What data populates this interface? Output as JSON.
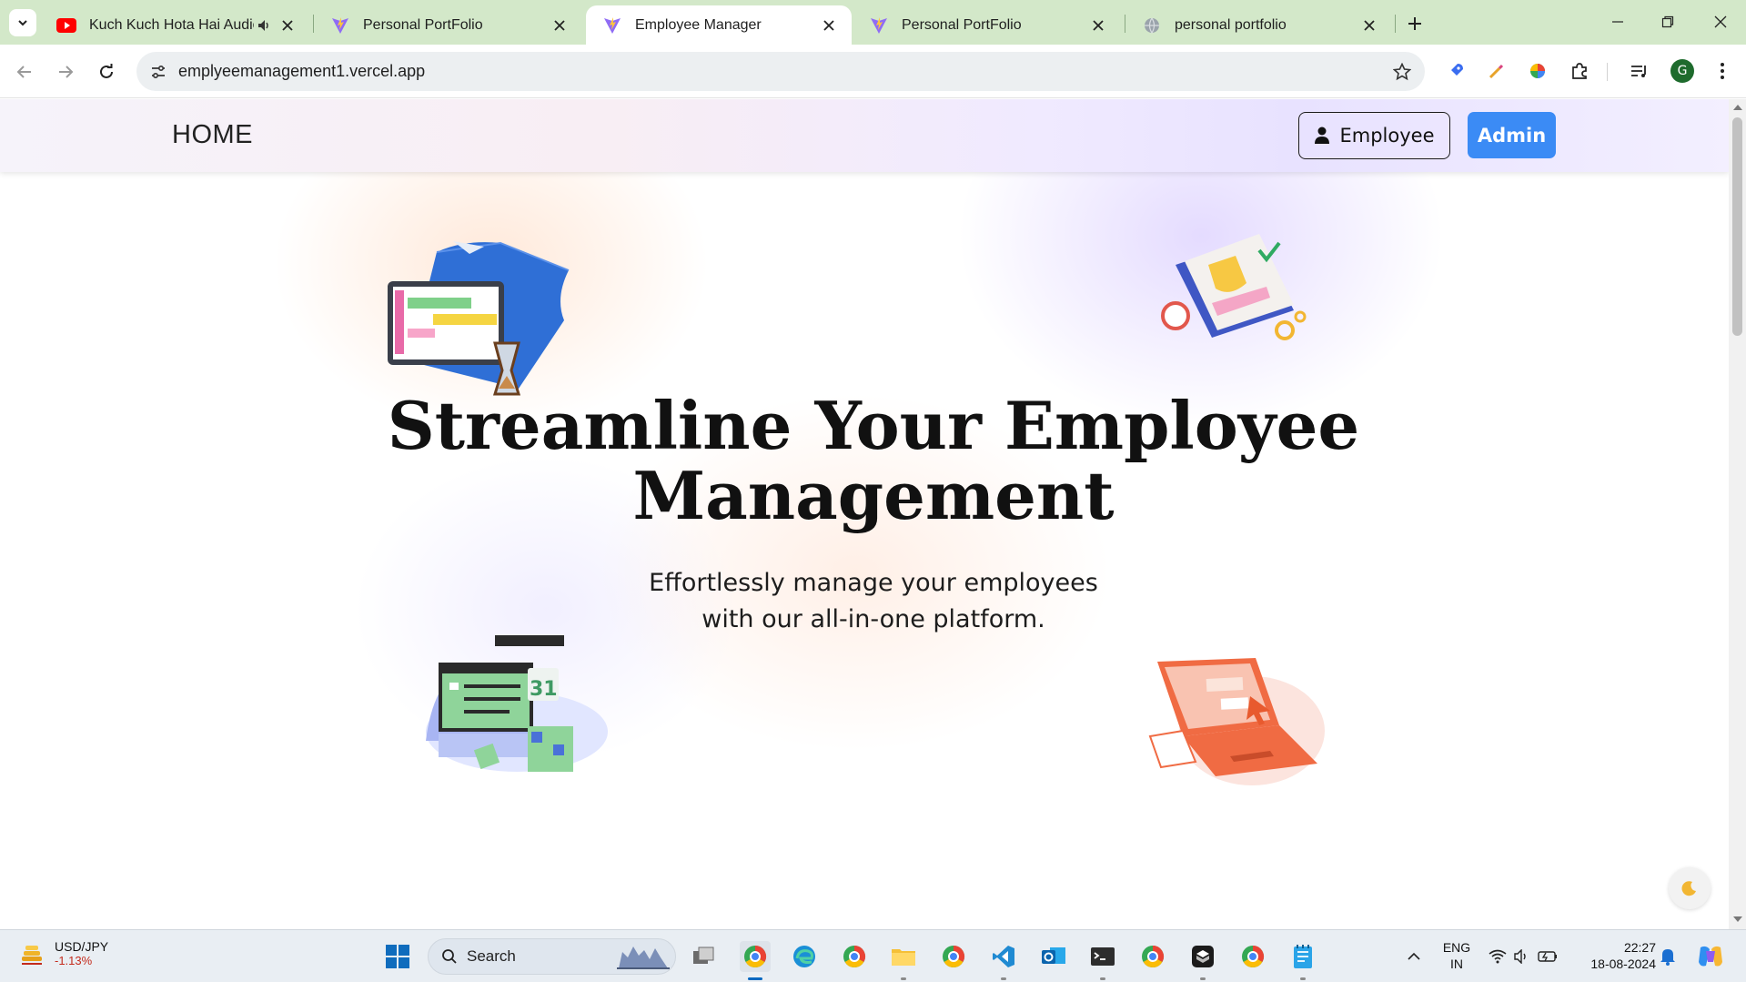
{
  "browser": {
    "tabs": [
      {
        "title": "Kuch Kuch Hota Hai Audio",
        "favicon": "youtube-icon",
        "audio": true,
        "active": false
      },
      {
        "title": "Personal PortFolio",
        "favicon": "vite-icon",
        "active": false
      },
      {
        "title": "Employee Manager",
        "favicon": "vite-icon",
        "active": true
      },
      {
        "title": "Personal PortFolio",
        "favicon": "vite-icon",
        "active": false
      },
      {
        "title": "personal portfolio",
        "favicon": "globe-icon",
        "active": false
      }
    ],
    "url": "emplyeemanagement1.vercel.app",
    "profile_initial": "G",
    "colors": {
      "tabstrip": "#d3e8c9",
      "omnibox": "#eceff1"
    }
  },
  "navbar": {
    "home_label": "HOME",
    "employee_label": "Employee",
    "admin_label": "Admin",
    "admin_color": "#3b8bf5"
  },
  "hero": {
    "title_line1": "Streamline Your Employee",
    "title_line2": "Management",
    "subtitle_line1": "Effortlessly manage your employees",
    "subtitle_line2": "with our all-in-one platform."
  },
  "illustrations": [
    "planner-blueprint-illustration",
    "calendar-checklist-illustration",
    "schedule-window-illustration",
    "laptop-illustration"
  ],
  "theme_toggle_icon": "moon-icon",
  "taskbar": {
    "widget_name": "USD/JPY",
    "widget_value": "-1.13%",
    "search_label": "Search",
    "lang_line1": "ENG",
    "lang_line2": "IN",
    "time": "22:27",
    "date": "18-08-2024"
  }
}
